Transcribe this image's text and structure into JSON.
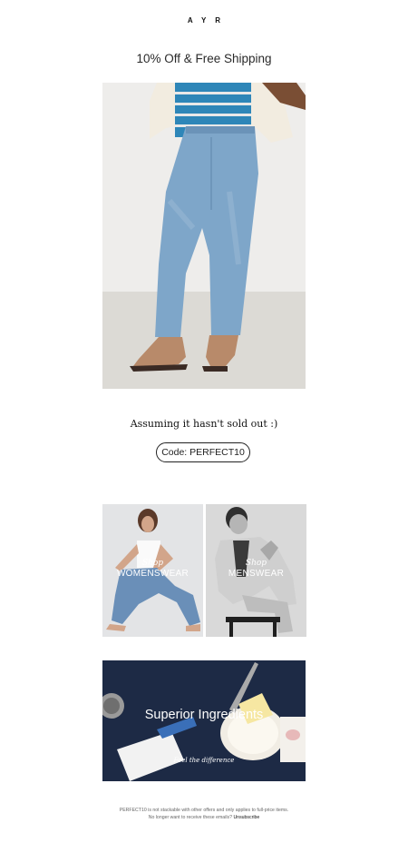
{
  "brand": {
    "logo": "AYR"
  },
  "promo": {
    "headline": "10% Off & Free Shipping"
  },
  "hero": {
    "alt": "Model wearing light-wash straight-leg jeans and striped tee"
  },
  "message": {
    "tagline": "Assuming it hasn't sold out :)"
  },
  "code_button": {
    "label": "Code: PERFECT10"
  },
  "tiles": [
    {
      "shop": "Shop",
      "title": "WOMENSWEAR"
    },
    {
      "shop": "Shop",
      "title": "MENSWEAR"
    }
  ],
  "ingredients": {
    "title": "Superior Ingredients",
    "subtitle": "Feel the difference"
  },
  "footer": {
    "disclaimer": "PERFECT10 is not stackable with other offers and only applies to full-price items.",
    "unsubscribe_prompt": "No longer want to receive these emails?",
    "unsubscribe_link": "Unsubscribe"
  },
  "colors": {
    "background": "#ffffff",
    "text": "#222222",
    "ingredients_bg": "#1d2a45",
    "stripe_blue": "#2e86b8"
  }
}
